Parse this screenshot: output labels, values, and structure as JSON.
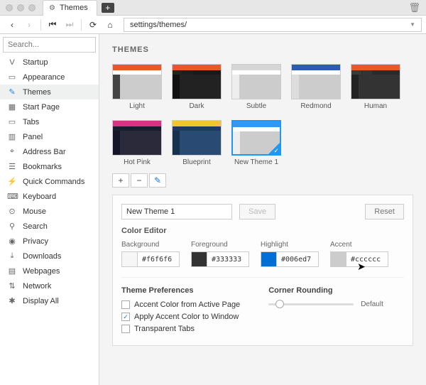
{
  "tab_title": "Themes",
  "url": "settings/themes/",
  "search_placeholder": "Search...",
  "sidebar": [
    {
      "icon": "V",
      "label": "Startup"
    },
    {
      "icon": "▭",
      "label": "Appearance"
    },
    {
      "icon": "✎",
      "label": "Themes",
      "active": true
    },
    {
      "icon": "▦",
      "label": "Start Page"
    },
    {
      "icon": "▭",
      "label": "Tabs"
    },
    {
      "icon": "▥",
      "label": "Panel"
    },
    {
      "icon": "⌖",
      "label": "Address Bar"
    },
    {
      "icon": "☰",
      "label": "Bookmarks"
    },
    {
      "icon": "⚡",
      "label": "Quick Commands"
    },
    {
      "icon": "⌨",
      "label": "Keyboard"
    },
    {
      "icon": "⊙",
      "label": "Mouse"
    },
    {
      "icon": "⚲",
      "label": "Search"
    },
    {
      "icon": "◉",
      "label": "Privacy"
    },
    {
      "icon": "⤓",
      "label": "Downloads"
    },
    {
      "icon": "▤",
      "label": "Webpages"
    },
    {
      "icon": "⇅",
      "label": "Network"
    },
    {
      "icon": "✱",
      "label": "Display All"
    }
  ],
  "page_heading": "THEMES",
  "themes": [
    {
      "name": "Light",
      "top": "#e9572b",
      "tab": "#fff",
      "side": "#444",
      "content": "#ccc",
      "body": "#fff"
    },
    {
      "name": "Dark",
      "top": "#e9572b",
      "tab": "#222",
      "side": "#111",
      "content": "#222",
      "body": "#1a1a1a"
    },
    {
      "name": "Subtle",
      "top": "#d6d6d6",
      "tab": "#fff",
      "side": "#eee",
      "content": "#ccc",
      "body": "#fff"
    },
    {
      "name": "Redmond",
      "top": "#2a5db0",
      "tab": "#fff",
      "side": "#ddd",
      "content": "#ccc",
      "body": "#fff"
    },
    {
      "name": "Human",
      "top": "#e9572b",
      "tab": "#3a3a3a",
      "side": "#222",
      "content": "#333",
      "body": "#2b2b2b"
    },
    {
      "name": "Hot Pink",
      "top": "#d63384",
      "tab": "#1b1b2e",
      "side": "#14142a",
      "content": "#2a2a3a",
      "body": "#1b1b2e"
    },
    {
      "name": "Blueprint",
      "top": "#f4c430",
      "tab": "#1f3a5f",
      "side": "#16304f",
      "content": "#294a72",
      "body": "#1f3a5f"
    },
    {
      "name": "New Theme 1",
      "top": "#3498f3",
      "tab": "#fff",
      "side": "#eee",
      "content": "#ccc",
      "body": "#fff",
      "selected": true
    }
  ],
  "editor": {
    "name_value": "New Theme 1",
    "save_label": "Save",
    "reset_label": "Reset",
    "heading": "Color Editor",
    "colors": [
      {
        "label": "Background",
        "value": "#f6f6f6",
        "swatch": "#f6f6f6"
      },
      {
        "label": "Foreground",
        "value": "#333333",
        "swatch": "#333333"
      },
      {
        "label": "Highlight",
        "value": "#006ed7",
        "swatch": "#006ed7"
      },
      {
        "label": "Accent",
        "value": "#cccccc",
        "swatch": "#cccccc"
      }
    ],
    "prefs_heading": "Theme Preferences",
    "prefs": [
      {
        "label": "Accent Color from Active Page",
        "checked": false
      },
      {
        "label": "Apply Accent Color to Window",
        "checked": true
      },
      {
        "label": "Transparent Tabs",
        "checked": false
      }
    ],
    "corner_heading": "Corner Rounding",
    "corner_value": "Default"
  }
}
